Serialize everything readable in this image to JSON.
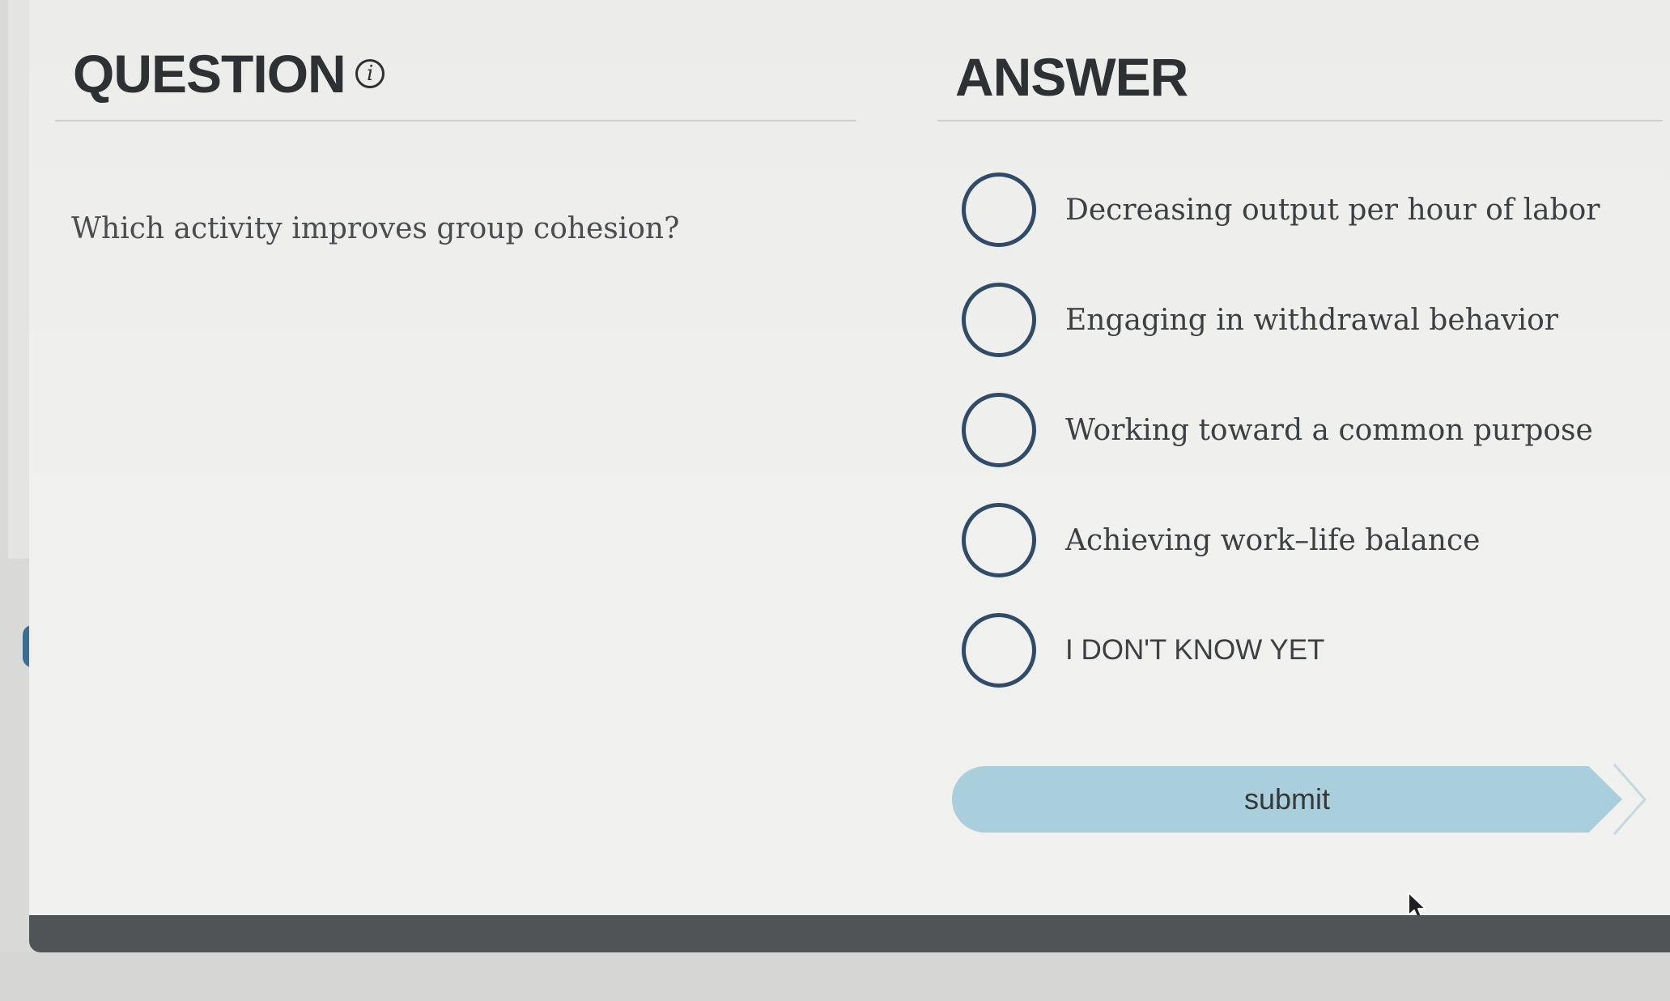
{
  "question_panel": {
    "heading": "QUESTION",
    "info_icon": "info-icon",
    "text": "Which activity improves group cohesion?"
  },
  "answer_panel": {
    "heading": "ANSWER",
    "options": [
      {
        "label": "Decreasing output per hour of labor",
        "selected": false
      },
      {
        "label": "Engaging in withdrawal behavior",
        "selected": false
      },
      {
        "label": "Working toward a common purpose",
        "selected": false
      },
      {
        "label": "Achieving work–life balance",
        "selected": false
      },
      {
        "label": "I DON'T KNOW YET",
        "selected": false
      }
    ]
  },
  "submit": {
    "label": "submit",
    "color": "#a8cfdb"
  },
  "colors": {
    "heading": "#2e3134",
    "radio_border": "#2f4b68",
    "bottom_bar": "#505457"
  }
}
